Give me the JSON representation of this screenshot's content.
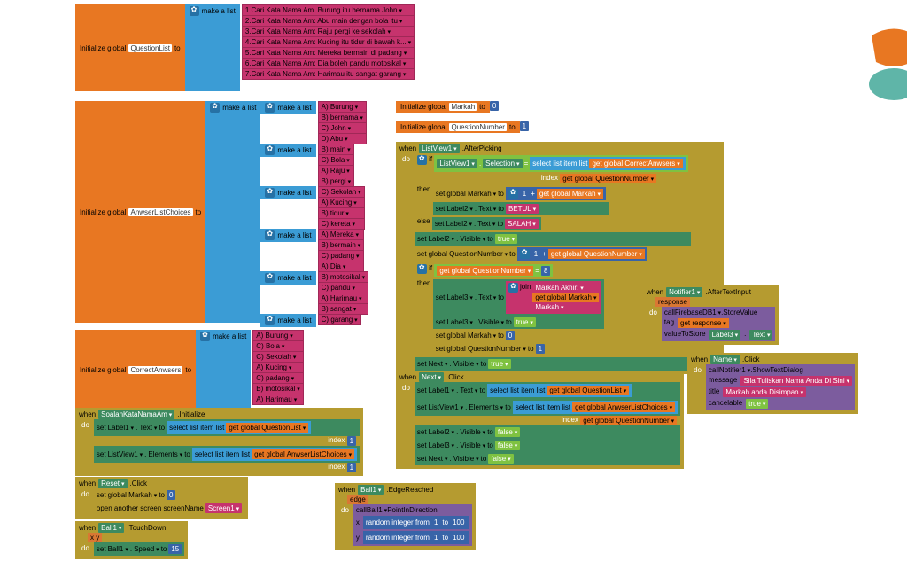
{
  "labels": {
    "initGlobal": "Initialize global",
    "to": "to",
    "makeAList": "make a list",
    "when": "when",
    "do": "do",
    "set": "set",
    "get": "get",
    "call": "call",
    "if": "if",
    "then": "then",
    "else": "else",
    "selectListItem": "select list item  list",
    "index": "index",
    "open": "open another screen  screenName",
    "elements": "Elements",
    "text": "Text",
    "visible": "Visible",
    "selection": "Selection",
    "join": "join",
    "randInt": "random integer from",
    "message": "message",
    "title": "title",
    "cancelable": "cancelable",
    "tag": "tag",
    "valueToStore": "valueToStore",
    "edge": "edge",
    "x": "x",
    "y": "y",
    "speed": "Speed",
    "pointDir": "PointInDirection"
  },
  "globals": {
    "questionList": "QuestionList",
    "answerListChoices": "AnwserListChoices",
    "correctAnswers": "CorrectAnwsers",
    "markah": "Markah",
    "questionNumber": "QuestionNumber"
  },
  "questionItems": [
    "1.Cari Kata Nama Am. Burung itu bernama John",
    "2.Cari Kata Nama Am: Abu main dengan bola itu",
    "3.Cari Kata Nama Am: Raju pergi ke sekolah",
    "4.Cari Kata Nama Am: Kucing itu tidur di bawah k...",
    "5.Cari Kata Nama Am: Mereka bermain di padang",
    "6.Cari Kata Nama Am: Dia boleh pandu motosikal",
    "7.Cari Kata Nama Am: Harimau itu sangat garang"
  ],
  "answerChoices": [
    [
      "A) Burung",
      "B) bernama",
      "C) John",
      "D) Abu"
    ],
    [
      "B) main",
      "C) Bola",
      "A) Raju",
      "B) pergi"
    ],
    [
      "C) Sekolah",
      "A) Kucing",
      "B) tidur",
      "C) kereta"
    ],
    [
      "A) Mereka",
      "B) bermain",
      "C) padang",
      "A) Dia"
    ],
    [
      "B) motosikal",
      "C) pandu",
      "A) Harimau",
      "B) sangat"
    ],
    [
      "C) garang"
    ]
  ],
  "correctList": [
    "A) Burung",
    "C) Bola",
    "C) Sekolah",
    "A) Kucing",
    "C) padang",
    "B) motosikal",
    "A) Harimau"
  ],
  "constants": {
    "zero": "0",
    "one": "1",
    "eight": "8",
    "fifteen": "15",
    "hundred": "100",
    "betul": "BETUL",
    "salah": "SALAH",
    "markahAkhir": "Markah Akhir:",
    "markah": "Markah",
    "screen1": "Screen1",
    "true": "true",
    "false": "false",
    "namaPrompt": "Sila Tuliskan Nama Anda Di Sini",
    "markahDisimpan": "Markah anda Disimpan"
  },
  "components": {
    "listview1": "ListView1",
    "label1": "Label1",
    "label2": "Label2",
    "label3": "Label3",
    "next": "Next",
    "reset": "Reset",
    "ball1": "Ball1",
    "notifier1": "Notifier1",
    "name": "Name",
    "firebase": "FirebaseDB1",
    "soalan": "SoalanKataNamaAm"
  },
  "events": {
    "initialize": ".Initialize",
    "click": ".Click",
    "afterPicking": ".AfterPicking",
    "touchDown": ".TouchDown",
    "edgeReached": ".EdgeReached",
    "afterTextInput": ".AfterTextInput",
    "storeValue": ".StoreValue",
    "showTextDialog": ".ShowTextDialog"
  },
  "eventParams": {
    "response": "response",
    "xy": "x  y"
  }
}
